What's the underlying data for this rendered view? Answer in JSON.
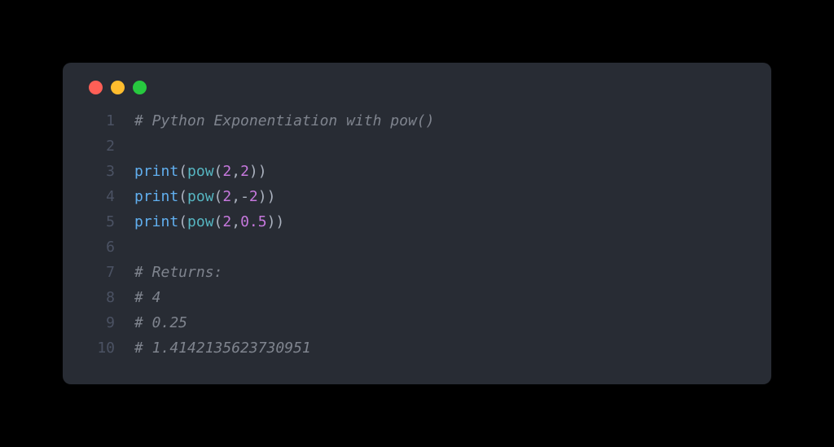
{
  "colors": {
    "background_page": "#000000",
    "background_window": "#282c34",
    "traffic_red": "#ff5f56",
    "traffic_yellow": "#ffbd2e",
    "traffic_green": "#27c93f",
    "line_number": "#4b5263",
    "comment": "#7f848e",
    "function": "#61afef",
    "builtin": "#56b6c2",
    "punctuation": "#abb2bf",
    "number": "#c678dd"
  },
  "code": {
    "lines": [
      {
        "n": "1",
        "tokens": [
          {
            "t": "# Python Exponentiation with pow()",
            "c": "tok-comment"
          }
        ]
      },
      {
        "n": "2",
        "tokens": []
      },
      {
        "n": "3",
        "tokens": [
          {
            "t": "print",
            "c": "tok-func"
          },
          {
            "t": "(",
            "c": "tok-punc"
          },
          {
            "t": "pow",
            "c": "tok-builtin"
          },
          {
            "t": "(",
            "c": "tok-punc"
          },
          {
            "t": "2",
            "c": "tok-number"
          },
          {
            "t": ",",
            "c": "tok-punc"
          },
          {
            "t": "2",
            "c": "tok-number"
          },
          {
            "t": "))",
            "c": "tok-punc"
          }
        ]
      },
      {
        "n": "4",
        "tokens": [
          {
            "t": "print",
            "c": "tok-func"
          },
          {
            "t": "(",
            "c": "tok-punc"
          },
          {
            "t": "pow",
            "c": "tok-builtin"
          },
          {
            "t": "(",
            "c": "tok-punc"
          },
          {
            "t": "2",
            "c": "tok-number"
          },
          {
            "t": ",",
            "c": "tok-punc"
          },
          {
            "t": "-",
            "c": "tok-op"
          },
          {
            "t": "2",
            "c": "tok-number"
          },
          {
            "t": "))",
            "c": "tok-punc"
          }
        ]
      },
      {
        "n": "5",
        "tokens": [
          {
            "t": "print",
            "c": "tok-func"
          },
          {
            "t": "(",
            "c": "tok-punc"
          },
          {
            "t": "pow",
            "c": "tok-builtin"
          },
          {
            "t": "(",
            "c": "tok-punc"
          },
          {
            "t": "2",
            "c": "tok-number"
          },
          {
            "t": ",",
            "c": "tok-punc"
          },
          {
            "t": "0.5",
            "c": "tok-number"
          },
          {
            "t": "))",
            "c": "tok-punc"
          }
        ]
      },
      {
        "n": "6",
        "tokens": []
      },
      {
        "n": "7",
        "tokens": [
          {
            "t": "# Returns:",
            "c": "tok-comment"
          }
        ]
      },
      {
        "n": "8",
        "tokens": [
          {
            "t": "# 4",
            "c": "tok-comment"
          }
        ]
      },
      {
        "n": "9",
        "tokens": [
          {
            "t": "# 0.25",
            "c": "tok-comment"
          }
        ]
      },
      {
        "n": "10",
        "tokens": [
          {
            "t": "# 1.4142135623730951",
            "c": "tok-comment"
          }
        ]
      }
    ]
  }
}
